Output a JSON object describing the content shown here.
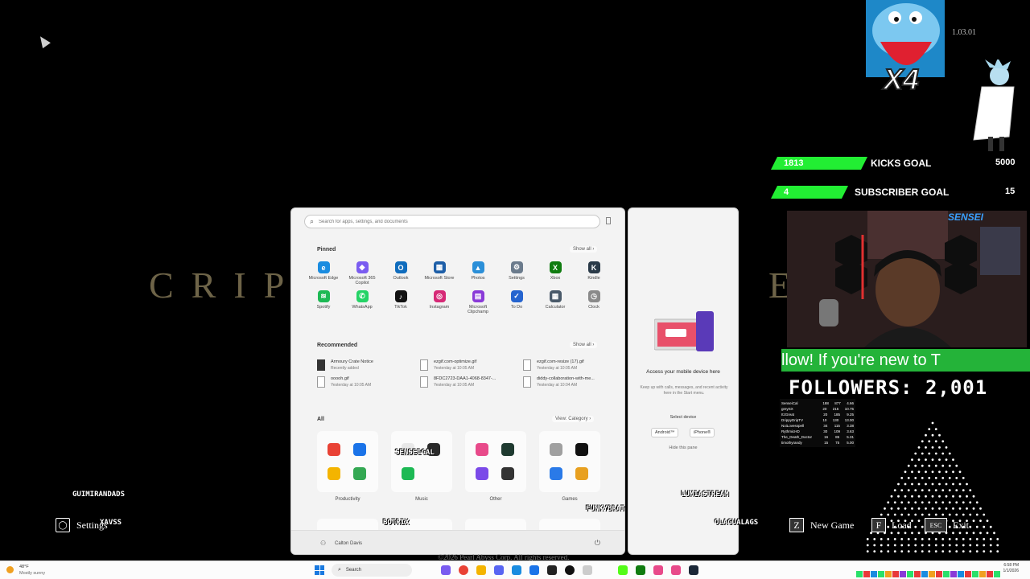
{
  "game": {
    "title_left": "CRIP",
    "title_right": "E",
    "version": "1.03.01",
    "copyright": "©2026 Pearl Abyss Corp. All rights reserved."
  },
  "start_menu": {
    "search_placeholder": "Search for apps, settings, and documents",
    "pinned_title": "Pinned",
    "show_all": "Show all",
    "pinned_apps": [
      {
        "label": "Microsoft Edge",
        "color": "#1a8ce0",
        "glyph": "e"
      },
      {
        "label": "Microsoft 365 Copilot",
        "color": "#7a5cf0",
        "glyph": "◆"
      },
      {
        "label": "Outlook",
        "color": "#0f6cbd",
        "glyph": "O"
      },
      {
        "label": "Microsoft Store",
        "color": "#1e5fa8",
        "glyph": "▦"
      },
      {
        "label": "Photos",
        "color": "#2b8fd8",
        "glyph": "▲"
      },
      {
        "label": "Settings",
        "color": "#6b7b8c",
        "glyph": "⚙"
      },
      {
        "label": "Xbox",
        "color": "#107c10",
        "glyph": "X"
      },
      {
        "label": "Kindle",
        "color": "#2a3a48",
        "glyph": "K"
      },
      {
        "label": "Spotify",
        "color": "#1db954",
        "glyph": "≋"
      },
      {
        "label": "WhatsApp",
        "color": "#25d366",
        "glyph": "✆"
      },
      {
        "label": "TikTok",
        "color": "#111111",
        "glyph": "♪"
      },
      {
        "label": "Instagram",
        "color": "#d62976",
        "glyph": "◎"
      },
      {
        "label": "Microsoft Clipchamp",
        "color": "#8a3ad8",
        "glyph": "▤"
      },
      {
        "label": "To Do",
        "color": "#2564cf",
        "glyph": "✓"
      },
      {
        "label": "Calculator",
        "color": "#4a5a6a",
        "glyph": "▦"
      },
      {
        "label": "Clock",
        "color": "#8a8a8a",
        "glyph": "◷"
      }
    ],
    "recommended_title": "Recommended",
    "recommended": [
      {
        "name": "Armoury Crate Notice",
        "detail": "Recently added",
        "dark": true
      },
      {
        "name": "ezgif.com-optimize.gif",
        "detail": "Yesterday at 10:05 AM",
        "dark": false
      },
      {
        "name": "ezgif.com-resize (17).gif",
        "detail": "Yesterday at 10:05 AM",
        "dark": false
      },
      {
        "name": "ooooh.gif",
        "detail": "Yesterday at 10:05 AM",
        "dark": false
      },
      {
        "name": "8FDC2723-DAA1-4068-8347-...",
        "detail": "Yesterday at 10:05 AM",
        "dark": false
      },
      {
        "name": "diddy-collaboration-with-me...",
        "detail": "Yesterday at 10:04 AM",
        "dark": false
      }
    ],
    "all_title": "All",
    "view_category": "View: Category",
    "categories": [
      {
        "label": "Productivity",
        "colors": [
          "#e94235",
          "#1a73e8",
          "#f4b400",
          "#34a853"
        ]
      },
      {
        "label": "Music",
        "colors": [
          "#e8e8e8",
          "#2a2a2a",
          "#1db954",
          "#fbfbfb"
        ]
      },
      {
        "label": "Other",
        "colors": [
          "#e84a8a",
          "#1f3a30",
          "#7b4ae8",
          "#333333"
        ]
      },
      {
        "label": "Games",
        "colors": [
          "#a0a0a0",
          "#111111",
          "#2a7ae8",
          "#e8a020"
        ]
      }
    ],
    "user_name": "Calton Davis"
  },
  "phone_pane": {
    "title": "Access your mobile device here",
    "description": "Keep up with calls, messages, and recent activity here in the Start menu.",
    "select_device": "Select device",
    "android": "Android™",
    "iphone": "iPhone®",
    "hide": "Hide this pane"
  },
  "overlay": {
    "kicks_current": "1813",
    "kicks_label": "KICKS GOAL",
    "kicks_target": "5000",
    "kicks_progress": 0.36,
    "subs_current": "4",
    "subs_label": "SUBSCRIBER GOAL",
    "subs_target": "15",
    "subs_progress": 0.27,
    "multiplier": "X4",
    "ticker": "llow!     If you're new to T",
    "followers": "FOLLOWERS: 2,001",
    "leaderboard": [
      [
        "SenseiCal",
        "188",
        "877",
        "4.66"
      ],
      [
        "greySX",
        "20",
        "215",
        "10.75"
      ],
      [
        "ItzGreat",
        "20",
        "185",
        "9.25"
      ],
      [
        "DrippyDripTV",
        "10",
        "130",
        "13.00"
      ],
      [
        "NoiLovesspell",
        "34",
        "115",
        "3.38"
      ],
      [
        "RythmicHD",
        "30",
        "109",
        "3.63"
      ],
      [
        "The_Death_Doctor",
        "16",
        "85",
        "5.31"
      ],
      [
        "timothyrandy",
        "15",
        "75",
        "5.00"
      ]
    ],
    "chat_names": {
      "n1": "GUIMIRANDADS",
      "n2": "XAVSS",
      "n3": "BOTRIX",
      "n4": "SENSEICAL",
      "n5": "FUNKYBRAT",
      "n6": "LUMIASTREAM",
      "n7": "OLAGUALAGS"
    }
  },
  "hud": {
    "settings_key": "◯",
    "settings_label": "Settings",
    "z_key": "Z",
    "new_game": "New Game",
    "f_key": "F",
    "load": "Load",
    "esc_key": "ESC",
    "exit": "Exit"
  },
  "taskbar": {
    "temp": "48°F",
    "condition": "Mostly sunny",
    "search": "Search",
    "time": "6:58 PM",
    "date": "1/1/2026"
  }
}
